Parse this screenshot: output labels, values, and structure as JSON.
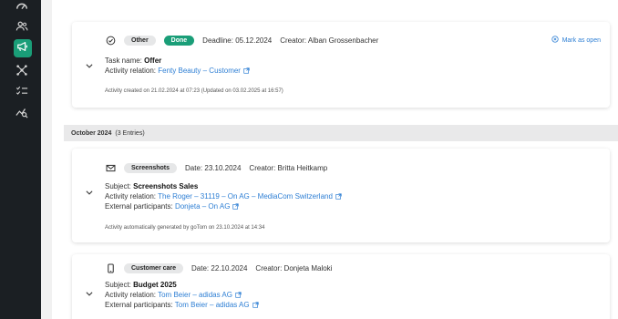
{
  "sidebar": {
    "items": [
      {
        "icon": "speedometer-icon",
        "active": false
      },
      {
        "icon": "users-icon",
        "active": false
      },
      {
        "icon": "megaphone-icon",
        "active": true
      },
      {
        "icon": "network-icon",
        "active": false
      },
      {
        "icon": "checklist-icon",
        "active": false
      },
      {
        "icon": "analytics-icon",
        "active": false
      }
    ],
    "accent": "#1a9e78"
  },
  "activity1": {
    "type_tag": "Other",
    "status_tag": "Done",
    "deadline": "Deadline: 05.12.2024",
    "creator": "Creator: Alban Grossenbacher",
    "mark_as_open": "Mark as open",
    "task_label": "Task name:",
    "task_value": "Offer",
    "relation_label": "Activity relation:",
    "relation_value": "Fenty Beauty – Customer",
    "meta": "Activity created on 21.02.2024 at 07:23 (Updated on 03.02.2025 at 16:57)"
  },
  "group": {
    "title": "October 2024",
    "count": "(3 Entries)"
  },
  "activity2": {
    "type_tag": "Screenshots",
    "date": "Date: 23.10.2024",
    "creator": "Creator: Britta Heitkamp",
    "subject_label": "Subject:",
    "subject_value": "Screenshots Sales",
    "relation_label": "Activity relation:",
    "relation_value": "The Roger – 31119 – On AG – MediaCom Switzerland",
    "participants_label": "External participants:",
    "participants_value": "Donjeta – On AG",
    "meta": "Activity automatically generated by goTom on 23.10.2024 at 14:34"
  },
  "activity3": {
    "type_tag": "Customer care",
    "date": "Date: 22.10.2024",
    "creator": "Creator: Donjeta Maloki",
    "subject_label": "Subject:",
    "subject_value": "Budget 2025",
    "relation_label": "Activity relation:",
    "relation_value": "Tom Beier – adidas AG",
    "participants_label": "External participants:",
    "participants_value": "Tom Beier – adidas AG"
  }
}
